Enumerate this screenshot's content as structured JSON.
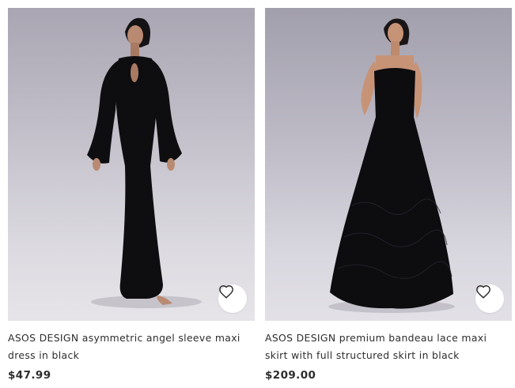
{
  "products": [
    {
      "name": "ASOS DESIGN asymmetric angel sleeve maxi dress in black",
      "price": "$47.99",
      "image_alt": "Model wearing black long-sleeve keyhole maxi dress",
      "save_icon": "heart-outline-icon"
    },
    {
      "name": "ASOS DESIGN premium bandeau lace maxi skirt with full structured skirt in black",
      "price": "$209.00",
      "image_alt": "Model wearing black strapless lace gown with full skirt",
      "save_icon": "heart-outline-icon"
    }
  ],
  "colors": {
    "text": "#2d2d2d",
    "card_background": "#ffffff",
    "photo_backdrop": "#c6c3cd"
  }
}
